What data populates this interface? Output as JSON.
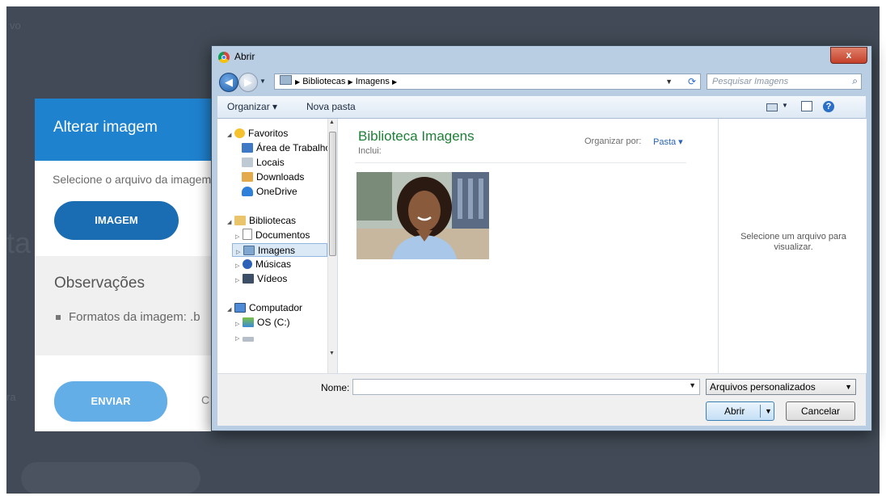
{
  "web_modal": {
    "title": "Alterar imagem",
    "description": "Selecione o arquivo da imagem",
    "image_button": "IMAGEM",
    "observations_title": "Observações",
    "observations_item": "Formatos da imagem: .b",
    "send_button": "ENVIAR",
    "cancel_partial": "C"
  },
  "dialog": {
    "title": "Abrir",
    "close_label": "x",
    "breadcrumb": [
      "Bibliotecas",
      "Imagens"
    ],
    "search_placeholder": "Pesquisar Imagens",
    "toolbar": {
      "organize": "Organizar ▾",
      "new_folder": "Nova pasta"
    },
    "tree": {
      "favorites": "Favoritos",
      "desktop": "Área de Trabalho",
      "recent": "Locais",
      "downloads": "Downloads",
      "onedrive": "OneDrive",
      "libraries": "Bibliotecas",
      "documents": "Documentos",
      "pictures": "Imagens",
      "music": "Músicas",
      "videos": "Vídeos",
      "computer": "Computador",
      "os_drive": "OS (C:)"
    },
    "library_title": "Biblioteca Imagens",
    "library_includes": "Inclui:",
    "arrange_by_label": "Organizar por:",
    "arrange_by_value": "Pasta ▾",
    "preview_text": "Selecione um arquivo para visualizar.",
    "filename_label": "Nome:",
    "filename_value": "",
    "filter_value": "Arquivos personalizados",
    "open_button": "Abrir",
    "cancel_button": "Cancelar"
  },
  "colors": {
    "backdrop": "#414a56",
    "modal_header": "#1f82cf",
    "primary_button": "#1a6cb3",
    "send_button": "#64aee7",
    "library_title": "#1e7f36",
    "dialog_frame": "#b9cde3"
  }
}
